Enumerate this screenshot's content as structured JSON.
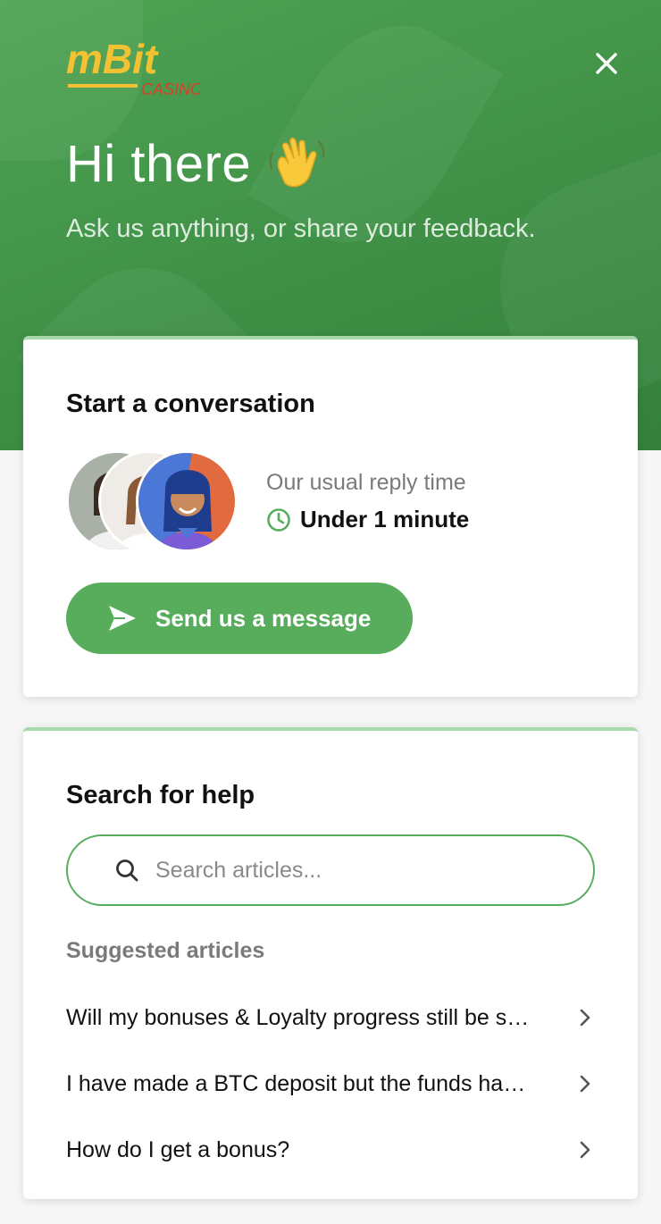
{
  "header": {
    "logo": {
      "brand": "mBit",
      "sub": "CASINO"
    },
    "greeting": "Hi there",
    "greeting_emoji": "waving-hand-icon",
    "subtitle": "Ask us anything, or share your feedback.",
    "close_icon": "close-icon",
    "background_color": "#449a4b"
  },
  "conversation": {
    "title": "Start a conversation",
    "reply_label": "Our usual reply time",
    "reply_time": "Under 1 minute",
    "reply_icon": "clock-icon",
    "send_button_label": "Send us a message",
    "send_icon": "paper-plane-icon",
    "accent_color": "#58ad5d"
  },
  "search": {
    "title": "Search for help",
    "placeholder": "Search articles...",
    "search_icon": "search-icon",
    "suggested_label": "Suggested articles",
    "articles": [
      {
        "label": "Will my bonuses & Loyalty progress still be saved?"
      },
      {
        "label": "I have made a BTC deposit but the funds have not arrived"
      },
      {
        "label": "How do I get a bonus?"
      }
    ],
    "chevron_icon": "chevron-right-icon"
  }
}
